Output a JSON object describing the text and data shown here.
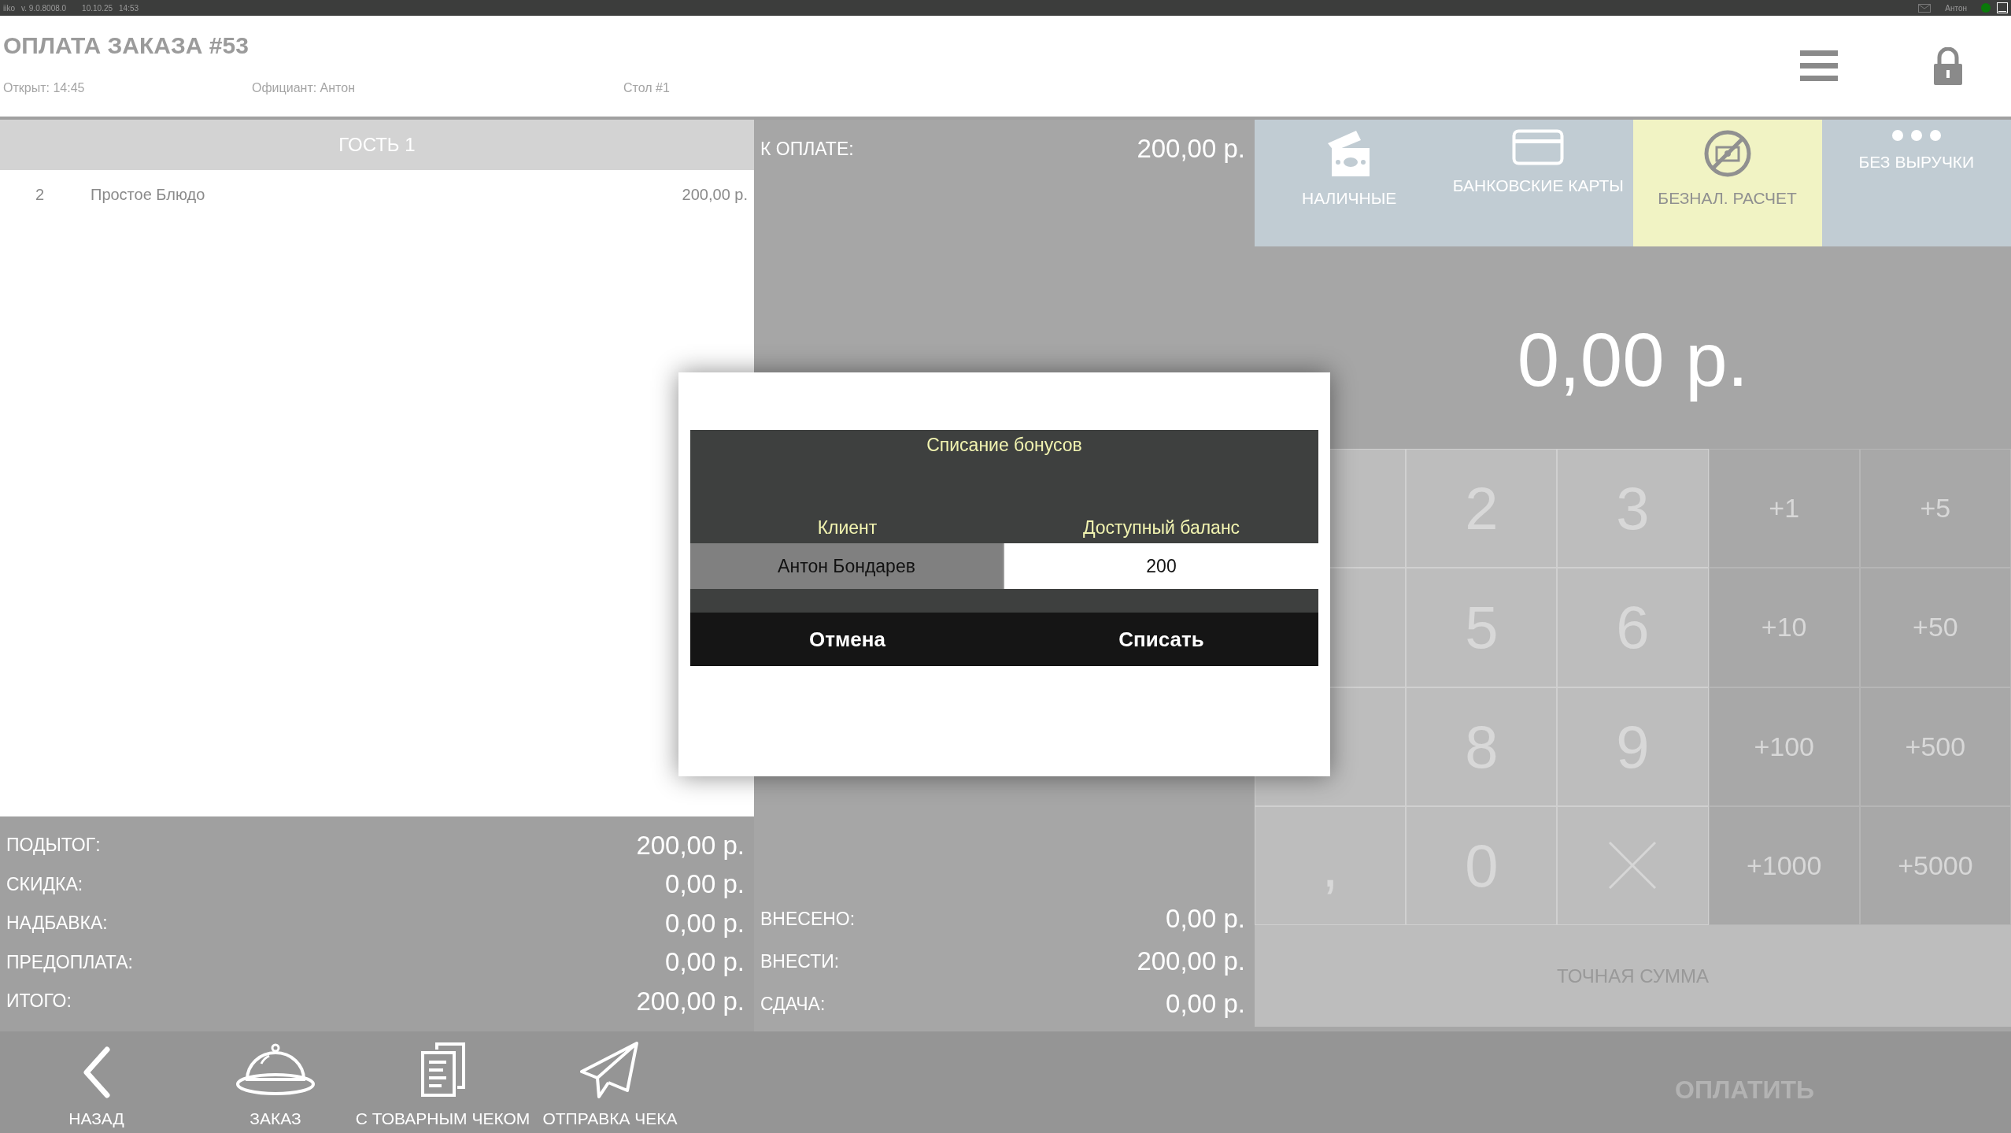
{
  "status_bar": {
    "app": "iiko",
    "version": "v. 9.0.8008.0",
    "date": "10.10.25",
    "time": "14:53",
    "user": "Антон",
    "online": true
  },
  "header": {
    "title": "ОПЛАТА ЗАКАЗА #53",
    "opened": "Открыт: 14:45",
    "waiter": "Официант: Антон",
    "table": "Стол #1"
  },
  "guest": {
    "title": "ГОСТЬ 1",
    "items": [
      {
        "qty": "2",
        "name": "Простое Блюдо",
        "price": "200,00 р."
      }
    ]
  },
  "totals": [
    {
      "label": "ПОДЫТОГ:",
      "value": "200,00 р."
    },
    {
      "label": "СКИДКА:",
      "value": "0,00 р."
    },
    {
      "label": "НАДБАВКА:",
      "value": "0,00 р."
    },
    {
      "label": "ПРЕДОПЛАТА:",
      "value": "0,00 р."
    },
    {
      "label": "ИТОГО:",
      "value": "200,00 р."
    }
  ],
  "due": {
    "label": "К ОПЛАТЕ:",
    "value": "200,00 р."
  },
  "payment": [
    {
      "label": "ВНЕСЕНО:",
      "value": "0,00 р."
    },
    {
      "label": "ВНЕСТИ:",
      "value": "200,00 р."
    },
    {
      "label": "СДАЧА:",
      "value": "0,00 р."
    }
  ],
  "payment_types": [
    {
      "kind": "cash",
      "label": "НАЛИЧНЫЕ",
      "selected": false
    },
    {
      "kind": "card",
      "label": "БАНКОВСКИЕ КАРТЫ",
      "selected": false
    },
    {
      "kind": "cashless",
      "label": "БЕЗНАЛ. РАСЧЕТ",
      "selected": true
    },
    {
      "kind": "more",
      "label": "БЕЗ ВЫРУЧКИ",
      "selected": false
    }
  ],
  "entered_amount": "0,00 р.",
  "keypad": [
    {
      "kind": "digit"
    },
    {
      "kind": "digit",
      "label": "2"
    },
    {
      "kind": "digit",
      "label": "3"
    },
    {
      "kind": "add",
      "label": "+1"
    },
    {
      "kind": "add",
      "label": "+5"
    },
    {
      "kind": "digit"
    },
    {
      "kind": "digit",
      "label": "5"
    },
    {
      "kind": "digit",
      "label": "6"
    },
    {
      "kind": "add",
      "label": "+10"
    },
    {
      "kind": "add",
      "label": "+50"
    },
    {
      "kind": "digit"
    },
    {
      "kind": "digit",
      "label": "8"
    },
    {
      "kind": "digit",
      "label": "9"
    },
    {
      "kind": "add",
      "label": "+100"
    },
    {
      "kind": "add",
      "label": "+500"
    },
    {
      "kind": "digit",
      "label": ","
    },
    {
      "kind": "digit",
      "label": "0"
    },
    {
      "kind": "clear"
    },
    {
      "kind": "add",
      "label": "+1000"
    },
    {
      "kind": "add",
      "label": "+5000"
    }
  ],
  "exact_sum": "ТОЧНАЯ СУММА",
  "bottom_actions": [
    {
      "kind": "back",
      "label": "НАЗАД"
    },
    {
      "kind": "order",
      "label": "ЗАКАЗ"
    },
    {
      "kind": "receipt",
      "label": "С ТОВАРНЫМ ЧЕКОМ"
    },
    {
      "kind": "send",
      "label": "ОТПРАВКА ЧЕКА"
    }
  ],
  "pay_button": {
    "label": "ОПЛАТИТЬ",
    "disabled": true
  },
  "dialog": {
    "title": "Списание бонусов",
    "columns": [
      "Клиент",
      "Доступный баланс"
    ],
    "client": "Антон Бондарев",
    "balance": "200",
    "buttons": [
      "Отмена",
      "Списать"
    ]
  }
}
